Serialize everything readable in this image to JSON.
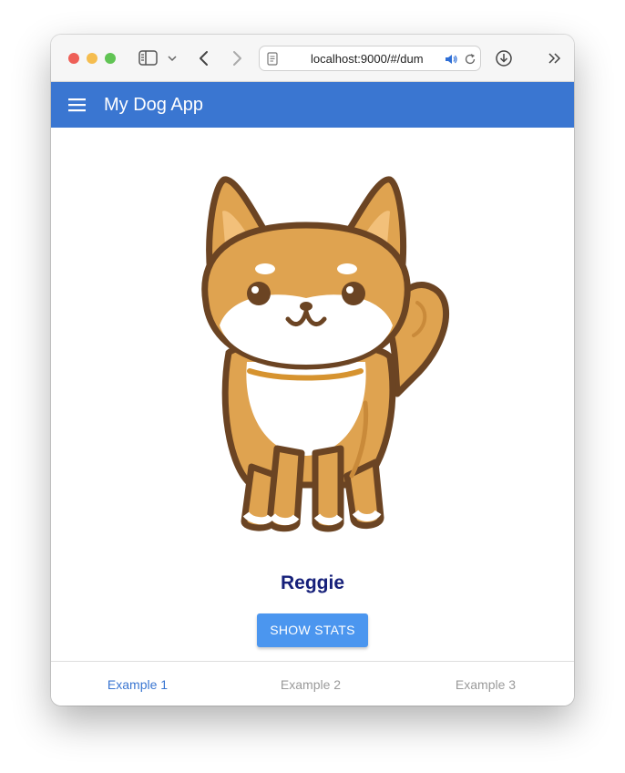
{
  "browser": {
    "url": "localhost:9000/#/dum",
    "icons": {
      "sidebar": "sidebar-icon",
      "chevron": "chevron-down-icon",
      "back": "chevron-left-icon",
      "forward": "chevron-right-icon",
      "page": "page-icon",
      "audio": "speaker-icon",
      "reload": "reload-icon",
      "download": "download-icon",
      "more": "double-chevron-icon"
    }
  },
  "app": {
    "title": "My Dog App",
    "accent_color": "#3a76d1",
    "menu_icon": "hamburger-menu-icon"
  },
  "main": {
    "dog_name": "Reggie",
    "button_label": "SHOW STATS"
  },
  "bottom_nav": {
    "tabs": [
      {
        "label": "Example 1",
        "active": true
      },
      {
        "label": "Example 2",
        "active": false
      },
      {
        "label": "Example 3",
        "active": false
      }
    ]
  }
}
